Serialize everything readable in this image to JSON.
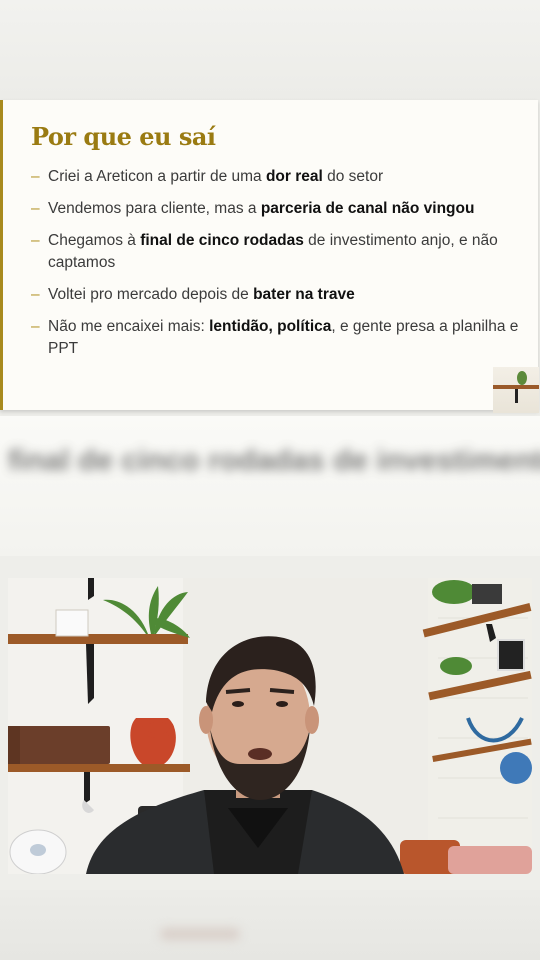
{
  "slide": {
    "title": "Por que eu saí",
    "bullets": [
      {
        "parts": [
          {
            "t": "Criei a Areticon a partir de uma ",
            "b": false
          },
          {
            "t": "dor real",
            "b": true
          },
          {
            "t": " do setor",
            "b": false
          }
        ]
      },
      {
        "parts": [
          {
            "t": "Vendemos para cliente, mas a ",
            "b": false
          },
          {
            "t": "parceria de canal não vingou",
            "b": true
          }
        ]
      },
      {
        "parts": [
          {
            "t": "Chegamos à ",
            "b": false
          },
          {
            "t": "final de cinco rodadas",
            "b": true
          },
          {
            "t": " de investimento anjo, e não captamos",
            "b": false
          }
        ]
      },
      {
        "parts": [
          {
            "t": "Voltei pro mercado depois de ",
            "b": false
          },
          {
            "t": "bater na trave",
            "b": true
          }
        ]
      },
      {
        "parts": [
          {
            "t": "Não me encaixei mais: ",
            "b": false
          },
          {
            "t": "lentidão, política",
            "b": true
          },
          {
            "t": ", e gente presa a planilha e PPT",
            "b": false
          }
        ]
      }
    ]
  },
  "blurred_caption": "final de cinco rodadas de investimento",
  "colors": {
    "title": "#9a7b12",
    "accent_border": "#a88a1e",
    "dash": "#b39428"
  },
  "icons": {
    "bullet": "dash"
  }
}
